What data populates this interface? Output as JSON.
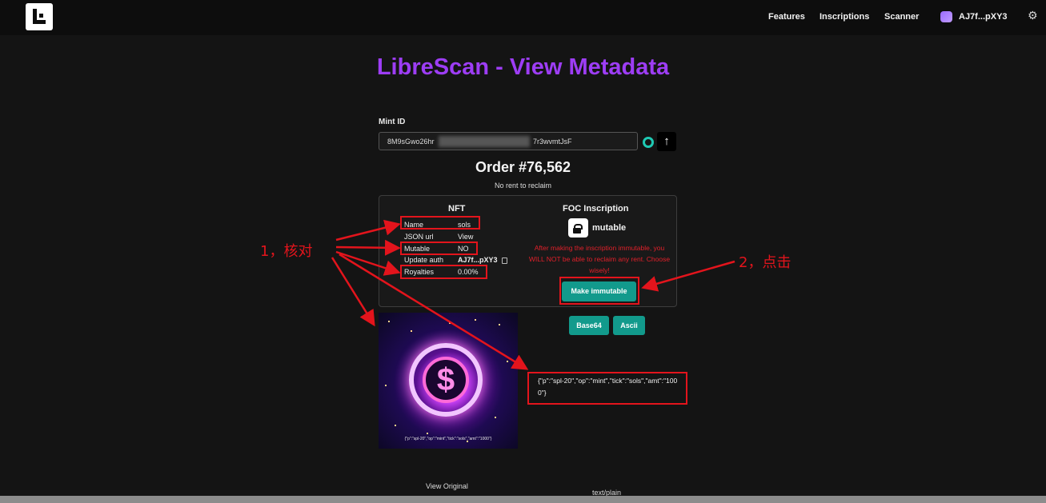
{
  "header": {
    "nav": [
      "Features",
      "Inscriptions",
      "Scanner"
    ],
    "wallet": "AJ7f...pXY3",
    "settings_icon": "gear-icon"
  },
  "page": {
    "title": "LibreScan - View Metadata",
    "mint_label": "Mint ID",
    "mint_id_start": "8M9sGwo26hr",
    "mint_id_end": "7r3wvmtJsF",
    "order": "Order #76,562",
    "rent": "No rent to reclaim"
  },
  "nft": {
    "heading": "NFT",
    "rows": [
      {
        "key": "Name",
        "value": "sols"
      },
      {
        "key": "JSON url",
        "value": "View"
      },
      {
        "key": "Mutable",
        "value": "NO"
      },
      {
        "key": "Update auth",
        "value": "AJ7f...pXY3"
      },
      {
        "key": "Royalties",
        "value": "0.00%"
      }
    ]
  },
  "foc": {
    "heading": "FOC Inscription",
    "state": "mutable",
    "warning": "After making the inscription immutable, you WILL NOT be able to reclaim any rent. Choose wisely!",
    "make_button": "Make immutable",
    "base64_button": "Base64",
    "ascii_button": "Ascii",
    "ascii_content": "{\"p\":\"spl-20\",\"op\":\"mint\",\"tick\":\"sols\",\"amt\":\"1000\"}"
  },
  "footer": {
    "view_original": "View Original",
    "mime": "text/plain"
  },
  "annotations": {
    "one": "1，核对",
    "two": "2，点击",
    "color": "#e3141c"
  },
  "colors": {
    "title": "#9d3df5",
    "button": "#129a8c",
    "warning": "#e0202a"
  }
}
